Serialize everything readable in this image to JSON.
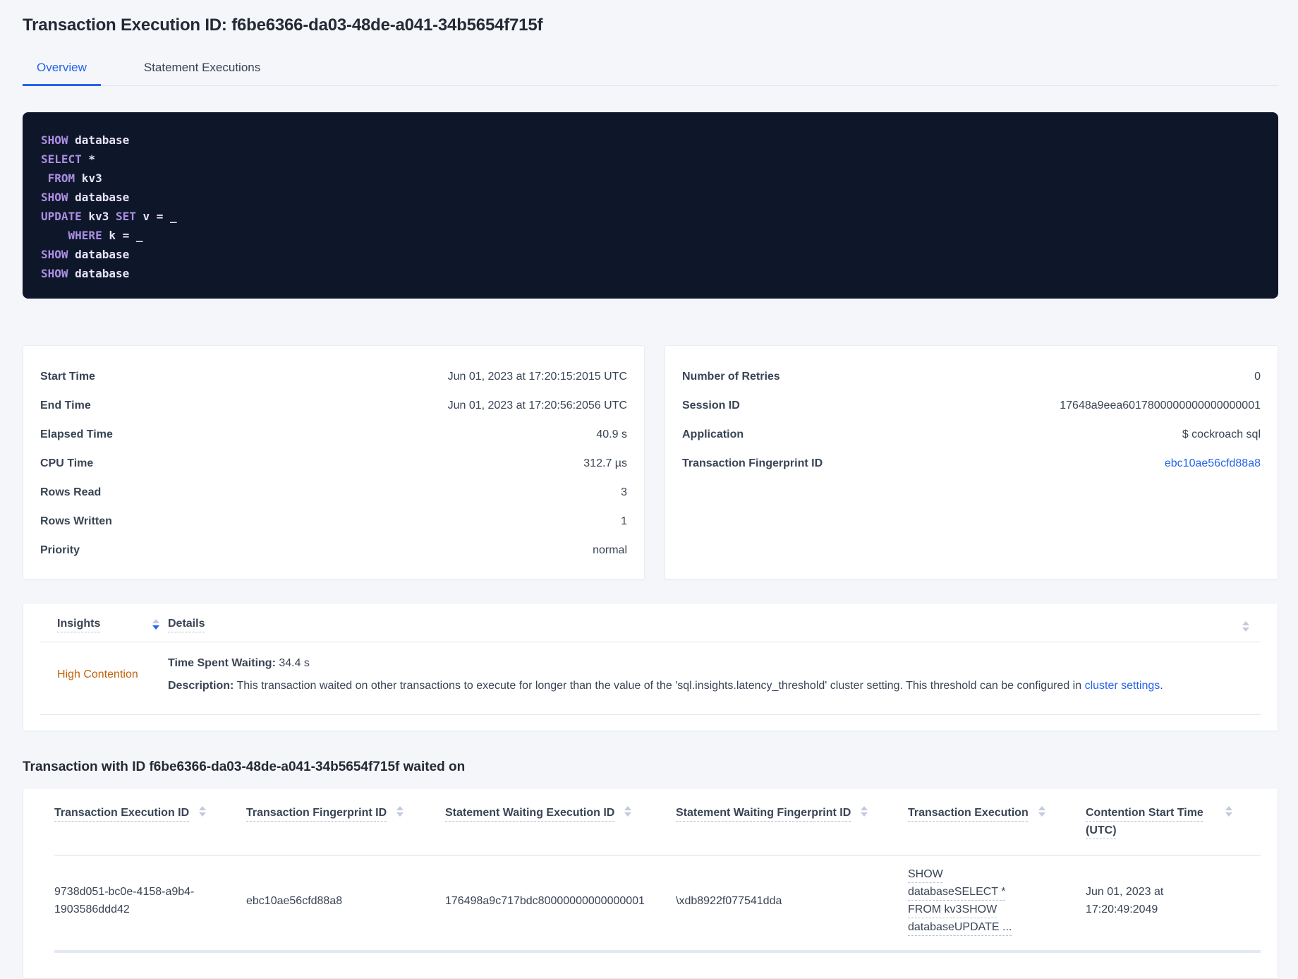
{
  "page": {
    "title": "Transaction Execution ID: f6be6366-da03-48de-a041-34b5654f715f"
  },
  "tabs": {
    "overview": "Overview",
    "statement_executions": "Statement Executions"
  },
  "sql_box": {
    "lines": [
      [
        {
          "type": "kw",
          "text": "SHOW"
        },
        {
          "type": "id",
          "text": " database"
        }
      ],
      [
        {
          "type": "kw",
          "text": "SELECT"
        },
        {
          "type": "id",
          "text": " *"
        }
      ],
      [
        {
          "type": "id",
          "text": " "
        },
        {
          "type": "kw",
          "text": "FROM"
        },
        {
          "type": "id",
          "text": " kv3"
        }
      ],
      [
        {
          "type": "kw",
          "text": "SHOW"
        },
        {
          "type": "id",
          "text": " database"
        }
      ],
      [
        {
          "type": "kw",
          "text": "UPDATE"
        },
        {
          "type": "id",
          "text": " kv3 "
        },
        {
          "type": "kw",
          "text": "SET"
        },
        {
          "type": "id",
          "text": " v = _"
        }
      ],
      [
        {
          "type": "id",
          "text": "    "
        },
        {
          "type": "kw",
          "text": "WHERE"
        },
        {
          "type": "id",
          "text": " k = _"
        }
      ],
      [
        {
          "type": "kw",
          "text": "SHOW"
        },
        {
          "type": "id",
          "text": " database"
        }
      ],
      [
        {
          "type": "kw",
          "text": "SHOW"
        },
        {
          "type": "id",
          "text": " database"
        }
      ]
    ]
  },
  "overview_left": {
    "rows": [
      {
        "label": "Start Time",
        "value": "Jun 01, 2023 at 17:20:15:2015 UTC"
      },
      {
        "label": "End Time",
        "value": "Jun 01, 2023 at 17:20:56:2056 UTC"
      },
      {
        "label": "Elapsed Time",
        "value": "40.9 s"
      },
      {
        "label": "CPU Time",
        "value": "312.7 µs"
      },
      {
        "label": "Rows Read",
        "value": "3"
      },
      {
        "label": "Rows Written",
        "value": "1"
      },
      {
        "label": "Priority",
        "value": "normal"
      }
    ]
  },
  "overview_right": {
    "rows": [
      {
        "label": "Number of Retries",
        "value": "0"
      },
      {
        "label": "Session ID",
        "value": "17648a9eea6017800000000000000001"
      },
      {
        "label": "Application",
        "value": "$ cockroach sql"
      },
      {
        "label": "Transaction Fingerprint ID",
        "value": "ebc10ae56cfd88a8"
      }
    ]
  },
  "insights": {
    "columns": {
      "insights": "Insights",
      "details": "Details"
    },
    "row": {
      "type": "High Contention",
      "waiting_label": "Time Spent Waiting:",
      "waiting_value": " 34.4 s",
      "description_label": "Description:",
      "description_text": " This transaction waited on other transactions to execute for longer than the value of the 'sql.insights.latency_threshold' cluster setting. This threshold can be configured in ",
      "description_link": "cluster settings",
      "description_suffix": "."
    }
  },
  "waited_section": {
    "title": "Transaction with ID f6be6366-da03-48de-a041-34b5654f715f waited on"
  },
  "waited_table": {
    "columns": [
      "Transaction Execution ID",
      "Transaction Fingerprint ID",
      "Statement Waiting Execution ID",
      "Statement Waiting Fingerprint ID",
      "Transaction Execution",
      "Contention Start Time (UTC)"
    ],
    "row": {
      "transaction_execution_id": "9738d051-bc0e-4158-a9b4-1903586ddd42",
      "transaction_fingerprint_id": "ebc10ae56cfd88a8",
      "statement_waiting_execution_id": "176498a9c717bdc80000000000000001",
      "statement_waiting_fingerprint_id": "\\xdb8922f077541dda",
      "transaction_execution": "SHOW databaseSELECT * FROM kv3SHOW databaseUPDATE ...",
      "contention_start_time": "Jun 01, 2023 at 17:20:49:2049"
    }
  },
  "colors": {
    "accent_blue": "#2563eb",
    "insight_warning_orange": "#c2610c",
    "code_background": "#0e1729",
    "code_keyword_purple": "#ab8ee3",
    "code_identifier": "#e7e3f6"
  }
}
